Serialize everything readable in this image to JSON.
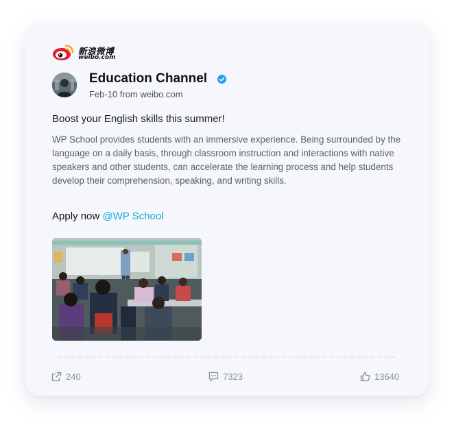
{
  "brand": {
    "logo_text_cn": "新浪微博",
    "logo_text_en": "weibo.com",
    "logo_color": "#e6162d",
    "logo_accent": "#f7a626"
  },
  "account": {
    "name": "Education Channel",
    "verified_icon": "verified-check-icon",
    "verified_color": "#1da1f2",
    "post_meta": "Feb-10 from weibo.com"
  },
  "post": {
    "headline": "Boost your English skills this summer!",
    "body": "WP School provides students with an immersive experience. Being surrounded by the language on a daily basis, through classroom instruction and interactions with native speakers and other students, can accelerate the learning process and help students develop their comprehension, speaking, and writing skills.",
    "cta_text": "Apply now",
    "mention": "@WP School",
    "mention_color": "#1ba9d8"
  },
  "actions": {
    "repost": {
      "icon": "share-icon",
      "count": "240"
    },
    "comment": {
      "icon": "comment-icon",
      "count": "7323"
    },
    "like": {
      "icon": "thumbs-up-icon",
      "count": "13640"
    }
  }
}
